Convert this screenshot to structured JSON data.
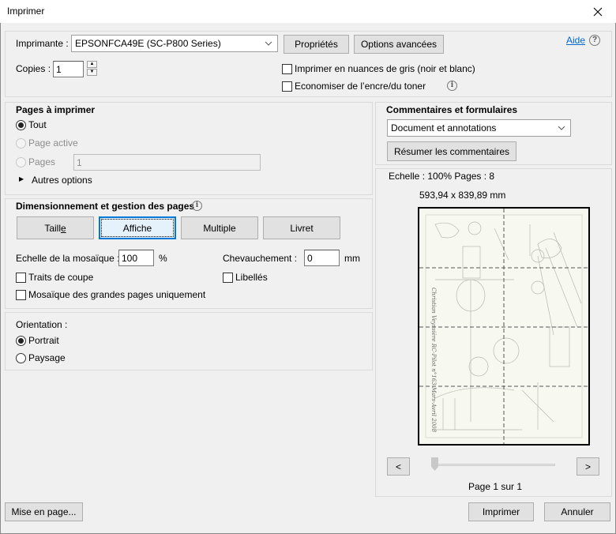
{
  "window": {
    "title": "Imprimer",
    "close_icon": "close-icon"
  },
  "printer": {
    "label": "Imprimante :",
    "selected": "EPSONFCA49E (SC-P800 Series)",
    "properties_button": "Propriétés",
    "advanced_button": "Options avancées",
    "help_link": "Aide",
    "copies_label": "Copies :",
    "copies_value": "1",
    "grayscale_label": "Imprimer en nuances de gris (noir et blanc)",
    "grayscale_checked": false,
    "save_ink_label": "Economiser de l’encre/du toner",
    "save_ink_checked": false
  },
  "pages_to_print": {
    "title": "Pages à imprimer",
    "options": [
      {
        "label": "Tout",
        "checked": true,
        "disabled": false
      },
      {
        "label": "Page active",
        "checked": false,
        "disabled": true
      },
      {
        "label": "Pages",
        "checked": false,
        "disabled": true
      }
    ],
    "pages_value": "1",
    "more_options": "Autres options"
  },
  "sizing": {
    "title": "Dimensionnement et gestion des pages",
    "buttons": [
      {
        "label": "Taille",
        "active": false
      },
      {
        "label": "Affiche",
        "active": true
      },
      {
        "label": "Multiple",
        "active": false
      },
      {
        "label": "Livret",
        "active": false
      }
    ],
    "tile_scale_label": "Echelle de la mosaïque :",
    "tile_scale_value": "100",
    "tile_scale_unit": "%",
    "overlap_label": "Chevauchement :",
    "overlap_value": "0",
    "overlap_unit": "mm",
    "cut_marks_label": "Traits de coupe",
    "cut_marks_checked": false,
    "labels_label": "Libellés",
    "labels_checked": false,
    "tile_large_label": "Mosaïque des grandes pages uniquement",
    "tile_large_checked": false
  },
  "orientation": {
    "title": "Orientation :",
    "options": [
      {
        "label": "Portrait",
        "checked": true
      },
      {
        "label": "Paysage",
        "checked": false
      }
    ]
  },
  "comments": {
    "title": "Commentaires et formulaires",
    "selected": "Document et annotations",
    "summarize_button": "Résumer les commentaires"
  },
  "preview": {
    "scale_text": "Echelle : 100% Pages : 8",
    "dimensions": "593,94 x 839,89 mm",
    "prev_button": "<",
    "next_button": ">",
    "page_indicator": "Page 1 sur 1",
    "tile_grid": {
      "columns": 2,
      "rows": 4
    },
    "document_text": "Christian Veyssière RC-Pilot n°163 Mars-Avril 2008"
  },
  "footer": {
    "page_setup_button": "Mise en page...",
    "print_button": "Imprimer",
    "cancel_button": "Annuler"
  }
}
